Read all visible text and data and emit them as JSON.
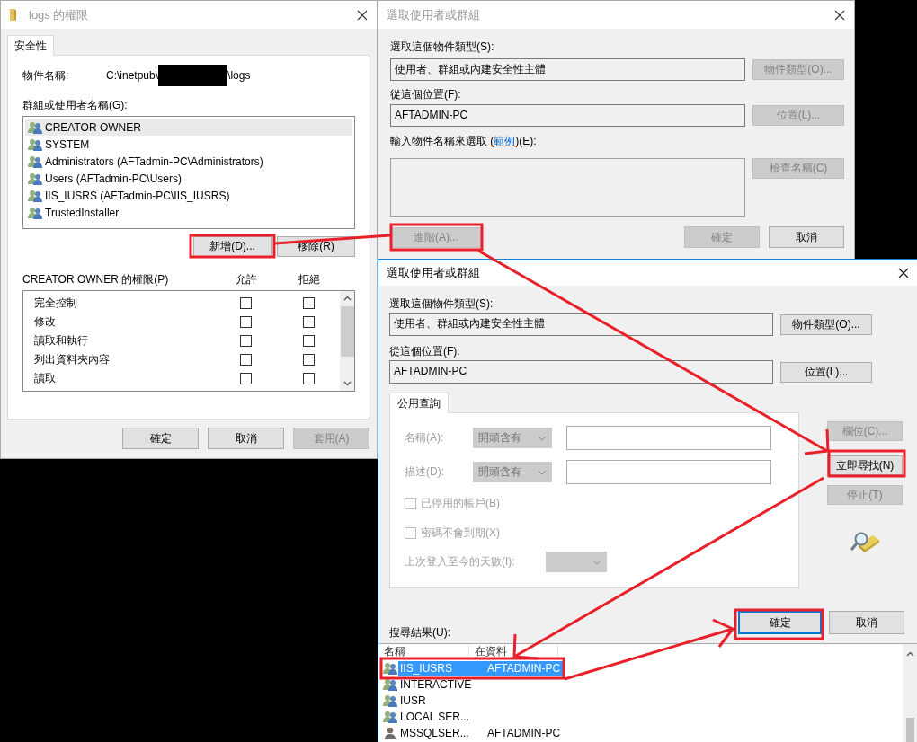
{
  "permissions_window": {
    "title": "logs 的權限",
    "active": false,
    "tabs": [
      {
        "label": "安全性",
        "selected": true
      }
    ],
    "object_name_label": "物件名稱:",
    "object_path_prefix": "C:\\inetpub\\",
    "object_path_suffix": "\\logs",
    "groups_label": "群組或使用者名稱(G):",
    "groups": [
      {
        "name": "CREATOR OWNER",
        "selected": true
      },
      {
        "name": "SYSTEM",
        "selected": false
      },
      {
        "name": "Administrators (AFTadmin-PC\\Administrators)",
        "selected": false
      },
      {
        "name": "Users (AFTadmin-PC\\Users)",
        "selected": false
      },
      {
        "name": "IIS_IUSRS (AFTadmin-PC\\IIS_IUSRS)",
        "selected": false
      },
      {
        "name": "TrustedInstaller",
        "selected": false
      }
    ],
    "group_buttons": [
      {
        "label": "新增(D)...",
        "disabled": false
      },
      {
        "label": "移除(R)",
        "disabled": false
      }
    ],
    "permissions_label": "CREATOR OWNER 的權限(P)",
    "allow_header": "允許",
    "deny_header": "拒絕",
    "permissions": [
      {
        "name": "完全控制",
        "allow": false,
        "deny": false
      },
      {
        "name": "修改",
        "allow": false,
        "deny": false
      },
      {
        "name": "讀取和執行",
        "allow": false,
        "deny": false
      },
      {
        "name": "列出資料夾內容",
        "allow": false,
        "deny": false
      },
      {
        "name": "讀取",
        "allow": false,
        "deny": false
      }
    ],
    "buttons": [
      {
        "label": "確定",
        "disabled": false
      },
      {
        "label": "取消",
        "disabled": false
      },
      {
        "label": "套用(A)",
        "disabled": true
      }
    ]
  },
  "select_window": {
    "title": "選取使用者或群組",
    "active": false,
    "object_type_label": "選取這個物件類型(S):",
    "object_type_value": "使用者、群組或內建安全性主體",
    "object_type_button": {
      "label": "物件類型(O)...",
      "disabled": true
    },
    "location_label": "從這個位置(F):",
    "location_value": "AFTADMIN-PC",
    "location_button": {
      "label": "位置(L)...",
      "disabled": true
    },
    "names_label_before": "輸入物件名稱來選取 (",
    "names_label_link": "範例",
    "names_label_after": ")(E):",
    "check_names_button": {
      "label": "檢查名稱(C)",
      "disabled": true
    },
    "advanced_button": {
      "label": "進階(A)...",
      "disabled": true
    },
    "buttons": [
      {
        "label": "確定",
        "disabled": true
      },
      {
        "label": "取消",
        "disabled": false
      }
    ]
  },
  "advanced_window": {
    "title": "選取使用者或群組",
    "active": true,
    "object_type_label": "選取這個物件類型(S):",
    "object_type_value": "使用者、群組或內建安全性主體",
    "object_type_button": {
      "label": "物件類型(O)...",
      "disabled": false
    },
    "location_label": "從這個位置(F):",
    "location_value": "AFTADMIN-PC",
    "location_button": {
      "label": "位置(L)...",
      "disabled": false
    },
    "tabs": [
      {
        "label": "公用查詢",
        "selected": true
      }
    ],
    "queries": [
      {
        "label": "名稱(A):",
        "operator": "開頭含有"
      },
      {
        "label": "描述(D):",
        "operator": "開頭含有"
      }
    ],
    "checkboxes": [
      {
        "label": "已停用的帳戶(B)",
        "checked": false,
        "disabled": true
      },
      {
        "label": "密碼不會到期(X)",
        "checked": false,
        "disabled": true
      }
    ],
    "days_label": "上次登入至今的天數(I):",
    "side_buttons": [
      {
        "label": "欄位(C)...",
        "disabled": true
      },
      {
        "label": "立即尋找(N)",
        "disabled": false
      },
      {
        "label": "停止(T)",
        "disabled": true
      }
    ],
    "results_label": "搜尋結果(U):",
    "buttons": [
      {
        "label": "確定",
        "disabled": false,
        "focused": true
      },
      {
        "label": "取消",
        "disabled": false,
        "focused": false
      }
    ],
    "result_columns": [
      "名稱",
      "在資料"
    ],
    "results": [
      {
        "name": "IIS_IUSRS",
        "folder": "AFTADMIN-PC",
        "kind": "group",
        "selected": true
      },
      {
        "name": "INTERACTIVE",
        "kind": "group",
        "selected": false
      },
      {
        "name": "IUSR",
        "kind": "group",
        "selected": false
      },
      {
        "name": "LOCAL SER...",
        "kind": "group",
        "selected": false
      },
      {
        "name": "MSSQLSER...",
        "folder": "AFTADMIN-PC",
        "kind": "user",
        "selected": false
      }
    ]
  }
}
